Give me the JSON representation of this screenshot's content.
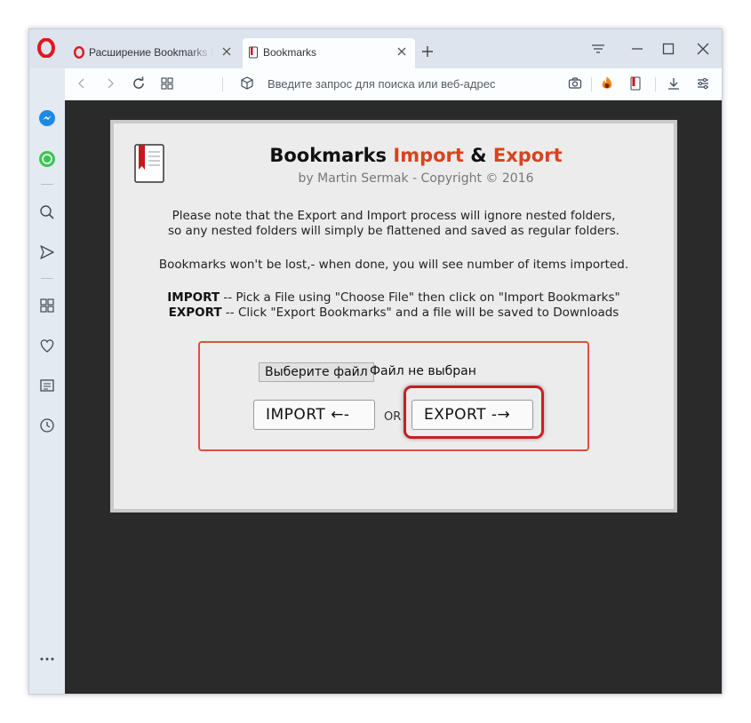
{
  "tabs": [
    {
      "title": "Расширение Bookmarks Import & Export",
      "active": false
    },
    {
      "title": "Bookmarks",
      "active": true
    }
  ],
  "address": {
    "placeholder": "Введите запрос для поиска или веб-адрес"
  },
  "page": {
    "title_part1": "Bookmarks ",
    "title_import": "Import",
    "title_amp": " & ",
    "title_export": "Export",
    "byline": "by Martin Sermak - Copyright © 2016",
    "note_line1": "Please note that the Export and Import process will ignore nested folders,",
    "note_line2": "so any nested folders will simply be flattened and saved as regular folders.",
    "note_line3": "Bookmarks won't be lost,- when done, you will see number of items imported.",
    "import_label": "IMPORT",
    "import_desc": " -- Pick a File using \"Choose File\" then click on \"Import Bookmarks\"",
    "export_label": "EXPORT",
    "export_desc": " -- Click \"Export Bookmarks\" and a file will be saved to Downloads",
    "choose_file": "Выберите файл",
    "file_status": "Файл не выбран",
    "import_button": "IMPORT  ←-",
    "or": "OR",
    "export_button": "EXPORT  -→"
  },
  "colors": {
    "accent_red": "#d8431f",
    "highlight": "#cc1c23",
    "opera_red": "#e0161e"
  }
}
